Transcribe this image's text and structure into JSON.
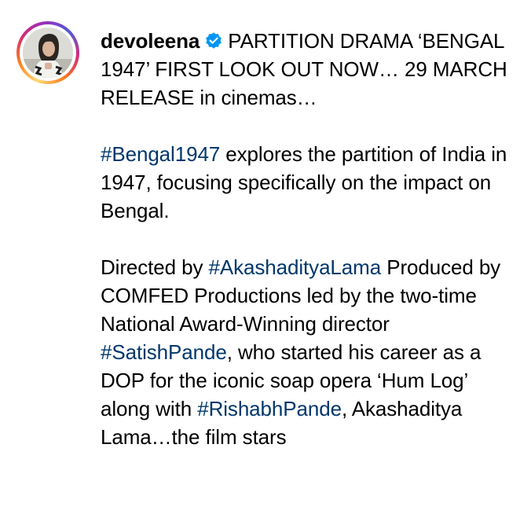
{
  "post": {
    "username": "devoleena",
    "verified_icon": "verified-badge-icon",
    "accent_colors": {
      "verified_blue": "#0095f6",
      "hashtag": "#00376b"
    }
  },
  "caption": {
    "p1": {
      "text": "PARTITION DRAMA ‘BENGAL 1947’ FIRST LOOK OUT NOW… 29 MARCH RELEASE in cinemas…"
    },
    "p2": {
      "tag": "#Bengal1947",
      "text": " explores the partition of India in 1947, focusing specifically on the impact on Bengal."
    },
    "p3": {
      "t1": "Directed by ",
      "tag1": "#AkashadityaLama",
      "t2": " Produced by COMFED Productions led by the two-time National Award-Winning director ",
      "tag2": "#SatishPande",
      "t3": ", who started his career as a DOP for the iconic soap opera ‘Hum Log’ along with ",
      "tag3": "#RishabhPande",
      "t4": ", Akashaditya Lama…the film stars"
    }
  }
}
